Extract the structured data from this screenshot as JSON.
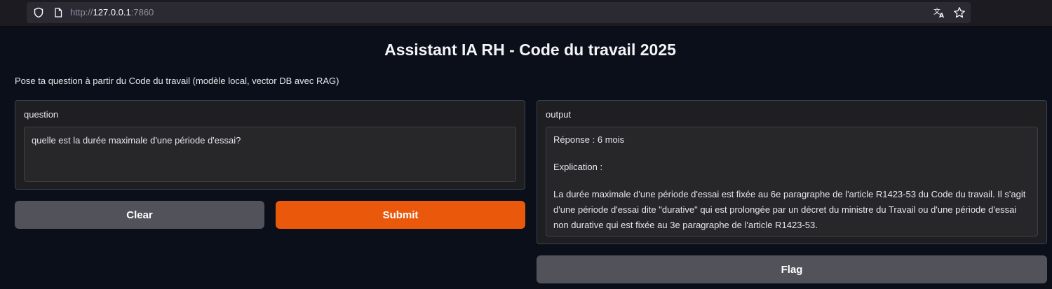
{
  "browser": {
    "url_prefix": "http://",
    "url_host": "127.0.0.1",
    "url_port": ":7860",
    "icons": [
      "shield-icon",
      "page-icon",
      "translate-icon",
      "star-icon"
    ]
  },
  "app": {
    "title": "Assistant IA RH - Code du travail 2025",
    "description": "Pose ta question à partir du Code du travail (modèle local, vector DB avec RAG)"
  },
  "input": {
    "label": "question",
    "value": "quelle est la durée maximale d'une période d'essai?"
  },
  "output": {
    "label": "output",
    "line1": "Réponse : 6 mois",
    "line2": "Explication :",
    "line3": "La durée maximale d'une période d'essai est fixée au 6e paragraphe de l'article R1423-53 du Code du travail. Il s'agit d'une période d'essai dite \"durative\" qui est prolongée par un décret du ministre du Travail ou d'une période d'essai non durative qui est fixée au 3e paragraphe de l'article R1423-53."
  },
  "buttons": {
    "clear": "Clear",
    "submit": "Submit",
    "flag": "Flag"
  },
  "colors": {
    "accent": "#ea580c",
    "secondary_button": "#52525b",
    "background": "#0b0f19"
  }
}
